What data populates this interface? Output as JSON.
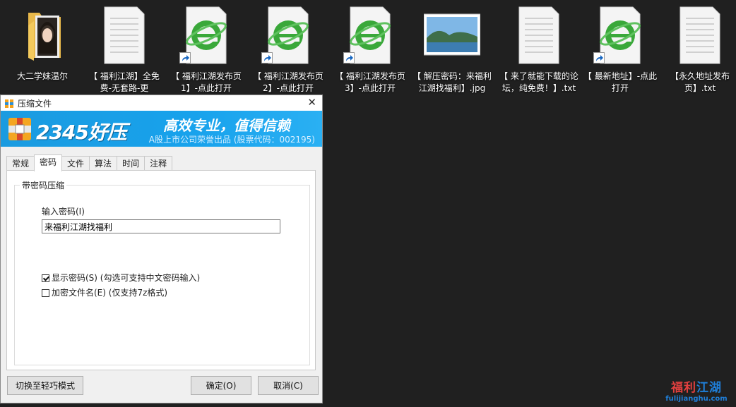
{
  "desktop": {
    "icons": [
      {
        "label": "大二学妹温尔",
        "type": "folder"
      },
      {
        "label": "【 福利江湖】全免费-无套路-更",
        "type": "txt"
      },
      {
        "label": "【 福利江湖发布页1】-点此打开",
        "type": "ie-shortcut"
      },
      {
        "label": "【 福利江湖发布页2】-点此打开",
        "type": "ie-shortcut"
      },
      {
        "label": "【 福利江湖发布页3】-点此打开",
        "type": "ie-shortcut"
      },
      {
        "label": "【 解压密码：来福利江湖找福利】.jpg",
        "type": "image"
      },
      {
        "label": "【 来了就能下载的论坛，纯免费！】.txt",
        "type": "txt"
      },
      {
        "label": "【 最新地址】-点此打开",
        "type": "ie-shortcut"
      },
      {
        "label": "【永久地址发布页】.txt",
        "type": "txt"
      }
    ]
  },
  "dialog": {
    "title": "压缩文件",
    "close_glyph": "✕",
    "banner": {
      "brand": "2345好压",
      "slogan": "高效专业，值得信赖",
      "sub": "A股上市公司荣誉出品 (股票代码：002195)"
    },
    "tabs": [
      "常规",
      "密码",
      "文件",
      "算法",
      "时间",
      "注释"
    ],
    "active_tab": "密码",
    "group_title": "带密码压缩",
    "password_label": "输入密码(I)",
    "password_value": "来福利江湖找福利",
    "show_password": {
      "label": "显示密码(S) (勾选可支持中文密码输入)",
      "checked": true
    },
    "encrypt_names": {
      "label": "加密文件名(E) (仅支持7z格式)",
      "checked": false
    },
    "buttons": {
      "simple_mode": "切换至轻巧模式",
      "ok": "确定(O)",
      "cancel": "取消(C)"
    }
  },
  "watermark": {
    "text_red": "福利",
    "text_blue": "江湖",
    "url": "fulijianghu.com"
  },
  "colors": {
    "desktop_bg": "#202020",
    "banner_blue": "#1a9be0",
    "ie_green": "#3aa83a"
  }
}
